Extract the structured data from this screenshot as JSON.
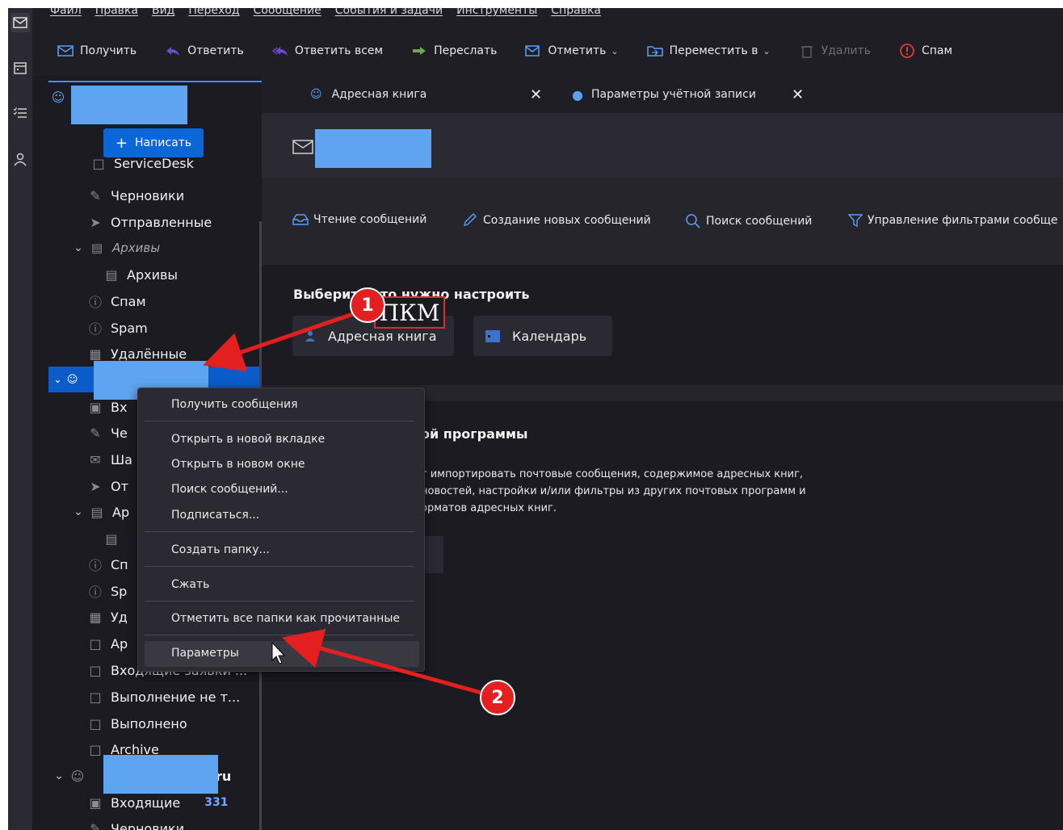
{
  "menubar": {
    "items": [
      "Файл",
      "Правка",
      "Вид",
      "Переход",
      "Сообщение",
      "События и задачи",
      "Инструменты",
      "Справка"
    ]
  },
  "toolbar": {
    "get": "Получить",
    "reply": "Ответить",
    "reply_all": "Ответить всем",
    "forward": "Переслать",
    "tag": "Отметить",
    "move": "Переместить в",
    "delete": "Удалить",
    "spam": "Спам"
  },
  "compose_label": "Написать",
  "folders_top": {
    "servicedesk": "ServiceDesk",
    "drafts": "Черновики",
    "sent": "Отправленные",
    "archives_group": "Архивы",
    "archives": "Архивы",
    "spam_ru": "Спам",
    "spam_en": "Spam",
    "trash": "Удалённые"
  },
  "folders_second": {
    "inbox": "Вх",
    "drafts": "Че",
    "templates": "Ша",
    "sent": "От",
    "archives": "Ар",
    "spam_ru": "Сп",
    "spam_en": "Sp",
    "trash": "Уд",
    "archive2": "Ар",
    "incoming_requests": "Входящие заявки ...",
    "not_done": "Выполнение не т...",
    "done": "Выполнено",
    "archive_en": "Archive"
  },
  "account_third": {
    "suffix": "ru",
    "inbox": "Входящие",
    "inbox_count": "331",
    "drafts": "Черновики"
  },
  "tabs": {
    "address_book": "Адресная книга",
    "account_settings": "Параметры учётной записи"
  },
  "quick_actions": {
    "read": "Чтение сообщений",
    "compose": "Создание новых сообщений",
    "search": "Поиск сообщений",
    "filters": "Управление фильтрами сообще"
  },
  "setup": {
    "title": "Выберите что нужно настроить",
    "address_book": "Адресная книга",
    "calendar": "Календарь"
  },
  "import": {
    "title": "ой программы",
    "line1": "т импортировать почтовые сообщения, содержимое адресных книг,",
    "line2": "новостей, настройки и/или фильтры из других почтовых программ и",
    "line3": "орматов адресных книг."
  },
  "context_menu": {
    "get_messages": "Получить сообщения",
    "open_tab": "Открыть в новой вкладке",
    "open_window": "Открыть в новом окне",
    "search": "Поиск сообщений...",
    "subscribe": "Подписаться...",
    "new_folder": "Создать папку...",
    "compact": "Сжать",
    "mark_read": "Отметить все папки как прочитанные",
    "settings": "Параметры"
  },
  "annotations": {
    "step1": "1",
    "step2": "2",
    "rmb": "ПКМ"
  },
  "colors": {
    "accent": "#0b67d8",
    "redaction": "#5fa4f0",
    "annotation_red": "#e41f1f"
  }
}
